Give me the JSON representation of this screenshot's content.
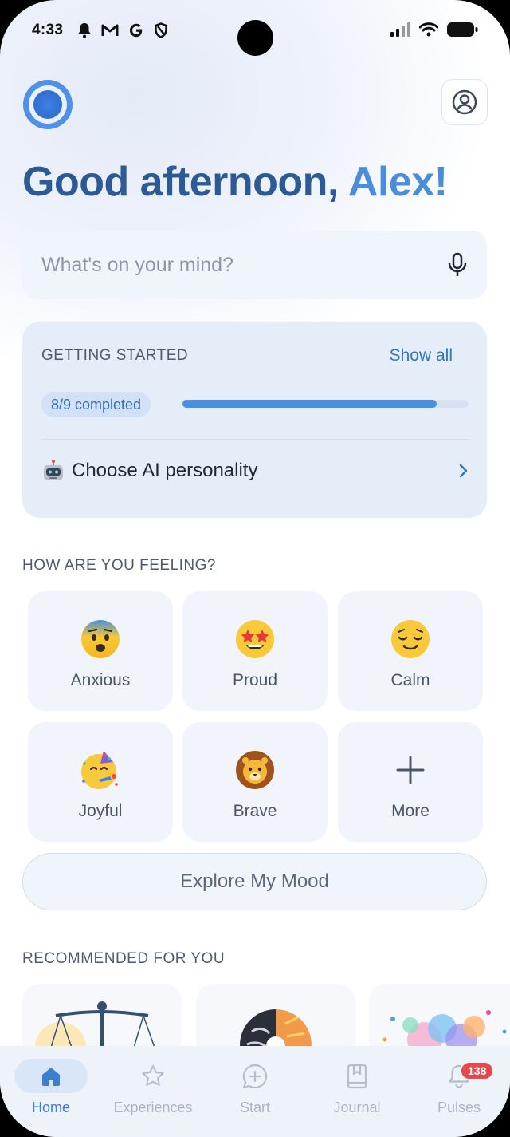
{
  "status_bar": {
    "time": "4:33"
  },
  "header": {
    "greeting_part1": "Good afternoon, ",
    "greeting_name": "Alex!"
  },
  "search": {
    "placeholder": "What's on your mind?"
  },
  "getting_started": {
    "title": "GETTING STARTED",
    "show_all": "Show all",
    "progress_label": "8/9 completed",
    "progress": {
      "done": 8,
      "total": 9
    },
    "next_step": "Choose AI personality",
    "next_step_icon": "robot-emoji"
  },
  "feelings": {
    "title": "HOW ARE YOU FEELING?",
    "items": [
      {
        "label": "Anxious",
        "icon": "anxious-face-emoji"
      },
      {
        "label": "Proud",
        "icon": "star-struck-emoji"
      },
      {
        "label": "Calm",
        "icon": "relieved-face-emoji"
      },
      {
        "label": "Joyful",
        "icon": "partying-face-emoji"
      },
      {
        "label": "Brave",
        "icon": "lion-emoji"
      },
      {
        "label": "More",
        "icon": "plus-icon"
      }
    ],
    "explore_button": "Explore My Mood"
  },
  "recommended": {
    "title": "RECOMMENDED FOR YOU"
  },
  "tabs": [
    {
      "label": "Home",
      "icon": "home-icon",
      "active": true
    },
    {
      "label": "Experiences",
      "icon": "star-icon"
    },
    {
      "label": "Start",
      "icon": "chat-plus-icon"
    },
    {
      "label": "Journal",
      "icon": "journal-icon"
    },
    {
      "label": "Pulses",
      "icon": "bell-icon",
      "badge": "138"
    }
  ],
  "colors": {
    "accent": "#4a8ddb",
    "primary_text": "#2c5a94",
    "badge": "#e5484d"
  }
}
